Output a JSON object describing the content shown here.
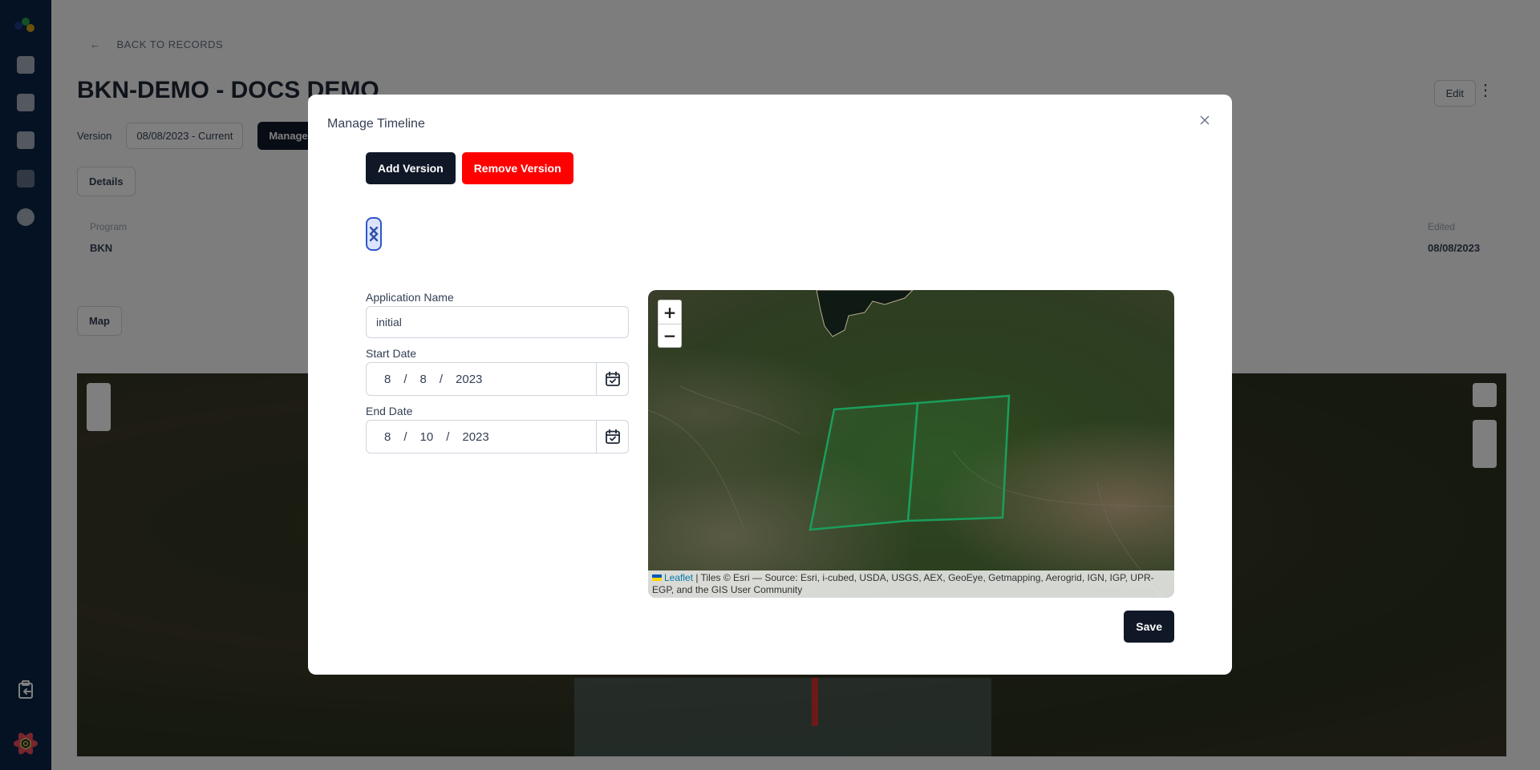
{
  "background": {
    "back_link": "BACK TO RECORDS",
    "title": "BKN-DEMO - DOCS DEMO",
    "version_label": "Version",
    "version_value": "08/08/2023 - Current",
    "manage_button": "Manage",
    "edit_button": "Edit",
    "tab_details": "Details",
    "tab_map": "Map",
    "fields": [
      {
        "label": "Program",
        "value": "BKN"
      },
      {
        "label": "Edited",
        "value": "08/08/2023"
      }
    ]
  },
  "modal": {
    "title": "Manage Timeline",
    "add_version_label": "Add Version",
    "remove_version_label": "Remove Version",
    "form": {
      "app_name_label": "Application Name",
      "app_name_value": "initial",
      "start_date_label": "Start Date",
      "start_date": {
        "month": "8",
        "day": "8",
        "year": "2023"
      },
      "end_date_label": "End Date",
      "end_date": {
        "month": "8",
        "day": "10",
        "year": "2023"
      },
      "date_separator": "/"
    },
    "map": {
      "zoom_in": "+",
      "zoom_out": "−",
      "attribution_link": "Leaflet",
      "attribution_text": " | Tiles © Esri — Source: Esri, i-cubed, USDA, USGS, AEX, GeoEye, Getmapping, Aerogrid, IGN, IGP, UPR-EGP, and the GIS User Community",
      "polygon_color": "#1a9e5c"
    },
    "save_label": "Save"
  },
  "colors": {
    "primary": "#101828",
    "danger": "#ff0000",
    "sidebar": "#0b2447",
    "handle": "#3155c8"
  }
}
